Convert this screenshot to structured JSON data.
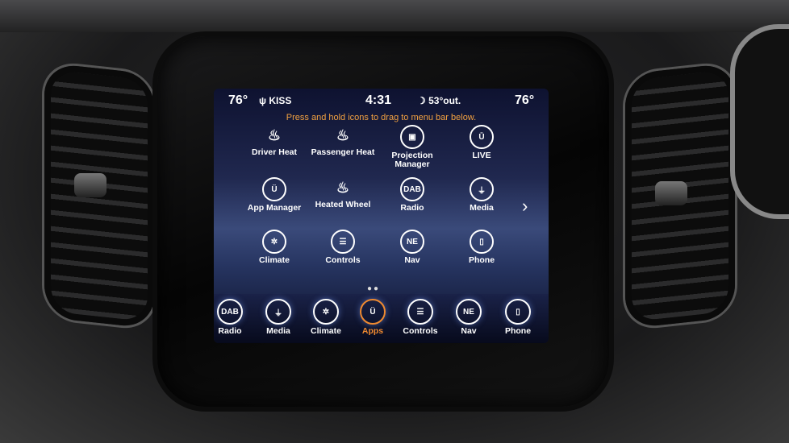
{
  "status": {
    "temp_left": "76°",
    "radio_station": "KISS",
    "time": "4:31",
    "outside_temp": "53°out.",
    "temp_right": "76°"
  },
  "hint": "Press and hold icons to drag to menu bar below.",
  "apps": [
    {
      "label": "Driver Heat",
      "icon": "seat-heat-icon",
      "glyph": "♨"
    },
    {
      "label": "Passenger Heat",
      "icon": "seat-heat-icon",
      "glyph": "♨"
    },
    {
      "label": "Projection Manager",
      "icon": "projection-icon",
      "glyph": "▣"
    },
    {
      "label": "LIVE",
      "icon": "uconnect-live-icon",
      "glyph": "Ū"
    },
    {
      "label": "App Manager",
      "icon": "app-manager-icon",
      "glyph": "Ü"
    },
    {
      "label": "Heated Wheel",
      "icon": "heated-wheel-icon",
      "glyph": "♨"
    },
    {
      "label": "Radio",
      "icon": "dab-icon",
      "glyph": "DAB"
    },
    {
      "label": "Media",
      "icon": "usb-icon",
      "glyph": "⏚"
    },
    {
      "label": "Climate",
      "icon": "climate-icon",
      "glyph": "✲"
    },
    {
      "label": "Controls",
      "icon": "controls-icon",
      "glyph": "☰"
    },
    {
      "label": "Nav",
      "icon": "compass-icon",
      "glyph": "NE"
    },
    {
      "label": "Phone",
      "icon": "phone-icon",
      "glyph": "▯"
    }
  ],
  "dock": [
    {
      "label": "Radio",
      "icon": "dab-icon",
      "glyph": "DAB"
    },
    {
      "label": "Media",
      "icon": "usb-icon",
      "glyph": "⏚"
    },
    {
      "label": "Climate",
      "icon": "climate-icon",
      "glyph": "✲"
    },
    {
      "label": "Apps",
      "icon": "apps-icon",
      "glyph": "Ü",
      "active": true
    },
    {
      "label": "Controls",
      "icon": "controls-icon",
      "glyph": "☰"
    },
    {
      "label": "Nav",
      "icon": "compass-icon",
      "glyph": "NE"
    },
    {
      "label": "Phone",
      "icon": "phone-icon",
      "glyph": "▯"
    }
  ],
  "colors": {
    "accent": "#f08a30",
    "hint": "#f0a040"
  }
}
